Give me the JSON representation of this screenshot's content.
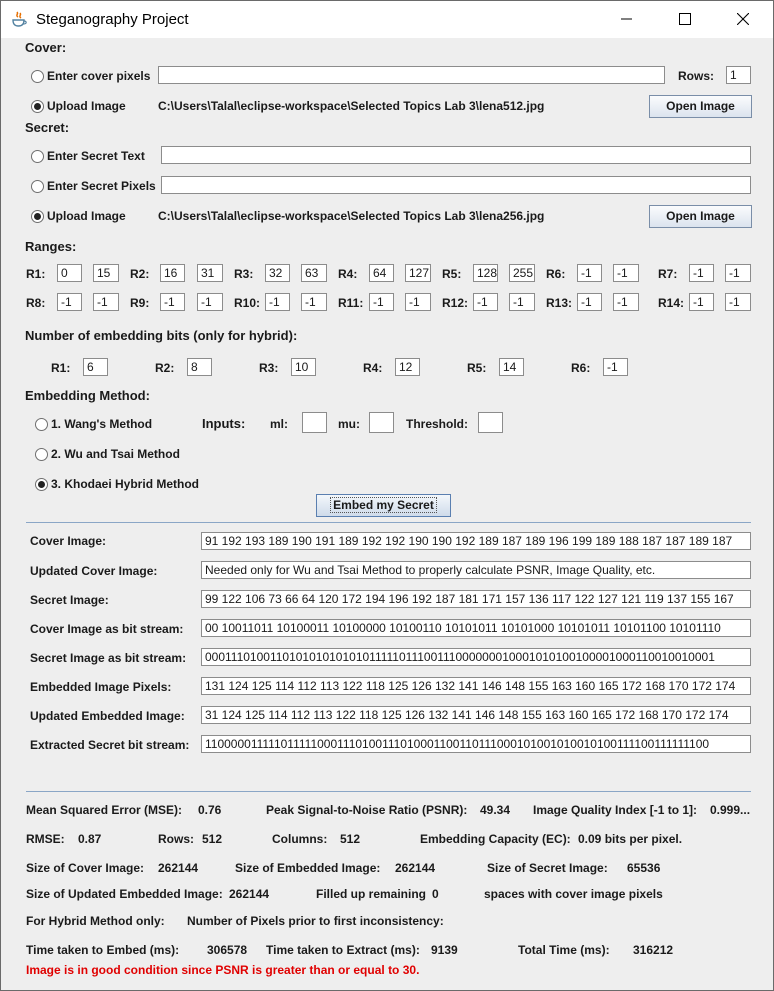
{
  "window": {
    "title": "Steganography Project"
  },
  "cover": {
    "heading": "Cover:",
    "enter_label": "Enter cover pixels",
    "rows_label": "Rows:",
    "rows_value": "1",
    "upload_label": "Upload Image",
    "path": "C:\\Users\\Talal\\eclipse-workspace\\Selected Topics Lab 3\\lena512.jpg",
    "open_label": "Open Image"
  },
  "secret": {
    "heading": "Secret:",
    "text_label": "Enter Secret Text",
    "pixels_label": "Enter Secret Pixels",
    "upload_label": "Upload Image",
    "path": "C:\\Users\\Talal\\eclipse-workspace\\Selected Topics Lab 3\\lena256.jpg",
    "open_label": "Open Image"
  },
  "ranges": {
    "heading": "Ranges:",
    "row1": [
      {
        "label": "R1:",
        "lo": "0",
        "hi": "15"
      },
      {
        "label": "R2:",
        "lo": "16",
        "hi": "31"
      },
      {
        "label": "R3:",
        "lo": "32",
        "hi": "63"
      },
      {
        "label": "R4:",
        "lo": "64",
        "hi": "127"
      },
      {
        "label": "R5:",
        "lo": "128",
        "hi": "255"
      },
      {
        "label": "R6:",
        "lo": "-1",
        "hi": "-1"
      },
      {
        "label": "R7:",
        "lo": "-1",
        "hi": "-1"
      }
    ],
    "row2": [
      {
        "label": "R8:",
        "lo": "-1",
        "hi": "-1"
      },
      {
        "label": "R9:",
        "lo": "-1",
        "hi": "-1"
      },
      {
        "label": "R10:",
        "lo": "-1",
        "hi": "-1"
      },
      {
        "label": "R11:",
        "lo": "-1",
        "hi": "-1"
      },
      {
        "label": "R12:",
        "lo": "-1",
        "hi": "-1"
      },
      {
        "label": "R13:",
        "lo": "-1",
        "hi": "-1"
      },
      {
        "label": "R14:",
        "lo": "-1",
        "hi": "-1"
      }
    ]
  },
  "bits": {
    "heading": "Number of embedding bits (only for hybrid):",
    "items": [
      {
        "label": "R1:",
        "value": "6"
      },
      {
        "label": "R2:",
        "value": "8"
      },
      {
        "label": "R3:",
        "value": "10"
      },
      {
        "label": "R4:",
        "value": "12"
      },
      {
        "label": "R5:",
        "value": "14"
      },
      {
        "label": "R6:",
        "value": "-1"
      }
    ]
  },
  "method": {
    "heading": "Embedding Method:",
    "wang": "1. Wang's Method",
    "wu": "2. Wu and Tsai Method",
    "khodaei": "3. Khodaei Hybrid Method",
    "inputs_label": "Inputs:",
    "ml_label": "ml:",
    "mu_label": "mu:",
    "threshold_label": "Threshold:",
    "embed_label": "Embed my Secret"
  },
  "outputs": [
    {
      "label": "Cover Image:",
      "value": "91 192 193 189 190 191 189 192 192 190 190 192 189 187 189 196 199 189 188 187 187 189 187"
    },
    {
      "label": "Updated Cover Image:",
      "value": "Needed only for Wu and Tsai Method to properly calculate PSNR, Image Quality, etc."
    },
    {
      "label": "Secret Image:",
      "value": "99 122 106 73 66 64 120 172 194 196 192 187 181 171 157 136 117 122 127 121 119 137 155 167"
    },
    {
      "label": "Cover Image as bit stream:",
      "value": "00 10011011 10100011 10100000 10100110 10101011 10101000 10101011 10101100 10101110"
    },
    {
      "label": "Secret Image as bit stream:",
      "value": "000111010011010101010101011111011100111000000010001010100100001000110010010001"
    },
    {
      "label": "Embedded Image Pixels:",
      "value": "131 124 125 114 112 113 122 118 125 126 132 141 146 148 155 163 160 165 172 168 170 172 174"
    },
    {
      "label": "Updated Embedded Image:",
      "value": "31 124 125 114 112 113 122 118 125 126 132 141 146 148 155 163 160 165 172 168 170 172 174"
    },
    {
      "label": "Extracted Secret bit stream:",
      "value": "1100000111110111110001110100111010001100110111000101001010010100111100111111100"
    }
  ],
  "stats": {
    "mse_label": "Mean Squared Error (MSE):",
    "mse_value": "0.76",
    "psnr_label": "Peak Signal-to-Noise Ratio (PSNR):",
    "psnr_value": "49.34",
    "iqi_label": "Image Quality Index [-1 to 1]:",
    "iqi_value": "0.999...",
    "rmse_label": "RMSE:",
    "rmse_value": "0.87",
    "rows_label": "Rows:",
    "rows_value": "512",
    "cols_label": "Columns:",
    "cols_value": "512",
    "ec_label": "Embedding Capacity (EC):",
    "ec_value": "0.09 bits per pixel.",
    "cover_size_label": "Size of Cover Image:",
    "cover_size_value": "262144",
    "emb_size_label": "Size of Embedded Image:",
    "emb_size_value": "262144",
    "secret_size_label": "Size of Secret Image:",
    "secret_size_value": "65536",
    "upd_emb_size_label": "Size of Updated Embedded Image:",
    "upd_emb_size_value": "262144",
    "filled_label": "Filled up remaining",
    "filled_value": "0",
    "filled_suffix": "spaces with cover image pixels",
    "hybrid_label": "For Hybrid Method only:",
    "hybrid_pixels_label": "Number of Pixels prior to first inconsistency:",
    "embed_time_label": "Time taken to Embed (ms):",
    "embed_time_value": "306578",
    "extract_time_label": "Time taken to Extract (ms):",
    "extract_time_value": "9139",
    "total_time_label": "Total Time (ms):",
    "total_time_value": "316212",
    "status": "Image is in good condition since PSNR is greater than or equal to 30."
  }
}
